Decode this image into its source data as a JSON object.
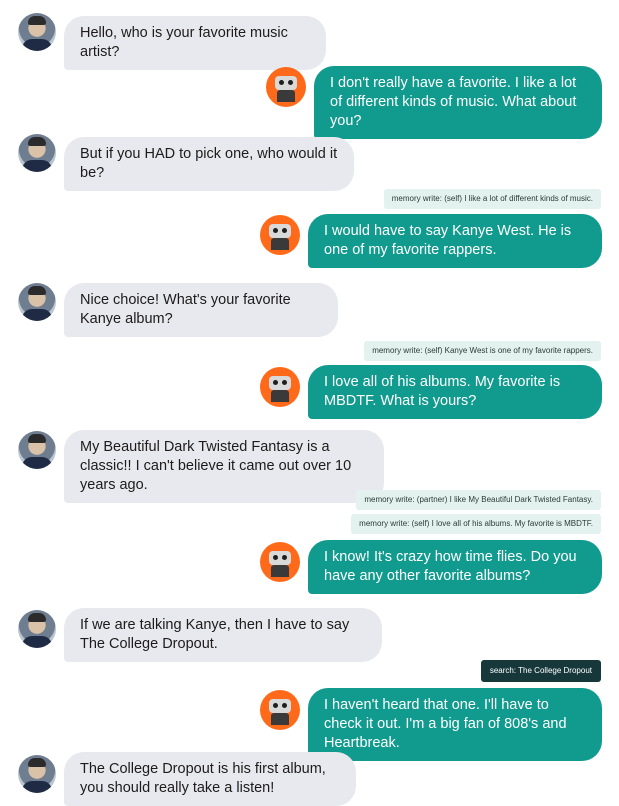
{
  "colors": {
    "user_bubble": "#e8e9ee",
    "bot_bubble": "#119a8e",
    "memory_tag": "#e3f1ef",
    "search_tag": "#16383b",
    "bot_avatar": "#ff6a1a"
  },
  "messages": [
    {
      "speaker": "user",
      "text": "Hello, who is your favorite music artist?"
    },
    {
      "speaker": "bot",
      "text": "I don't really have a favorite. I like a lot of different kinds of music. What about you?"
    },
    {
      "speaker": "user",
      "text": "But if you HAD to pick one, who would it be?"
    },
    {
      "speaker": "bot",
      "tags": [
        "memory write: (self) I like a lot of different kinds of music."
      ],
      "text": "I would have to say Kanye West. He is one of my favorite rappers."
    },
    {
      "speaker": "user",
      "text": "Nice choice! What's your favorite Kanye album?"
    },
    {
      "speaker": "bot",
      "tags": [
        "memory write: (self) Kanye West is one of my favorite rappers."
      ],
      "text": "I love all of his albums. My favorite is MBDTF. What is yours?"
    },
    {
      "speaker": "user",
      "text": "My Beautiful Dark Twisted Fantasy is a classic!! I can't believe it came out over 10 years ago."
    },
    {
      "speaker": "bot",
      "tags": [
        "memory write: (partner) I like My Beautiful Dark Twisted Fantasy.",
        "memory write: (self) I love all of his albums. My favorite is MBDTF."
      ],
      "text": "I know! It's crazy how time flies. Do you have any other favorite albums?"
    },
    {
      "speaker": "user",
      "text": "If we are talking Kanye, then I have to say The College Dropout."
    },
    {
      "speaker": "bot",
      "search": "search: The College Dropout",
      "text": "I haven't heard that one. I'll have to check it out. I'm a big fan of 808's and Heartbreak."
    },
    {
      "speaker": "user",
      "text": "The College Dropout is his first album, you should really take a listen!"
    }
  ]
}
